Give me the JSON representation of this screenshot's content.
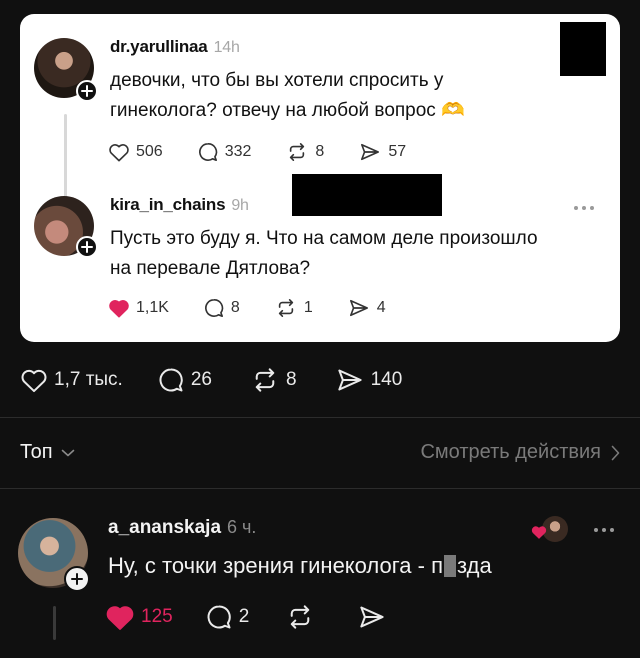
{
  "quoted_card": {
    "post": {
      "username": "dr.yarullinaa",
      "time": "14h",
      "text_line1": "девочки, что бы вы хотели спросить у",
      "text_line2": "гинеколога? отвечу на любой вопрос 🫶",
      "likes": "506",
      "replies": "332",
      "reposts": "8",
      "shares": "57"
    },
    "reply": {
      "username": "kira_in_chains",
      "time": "9h",
      "text_line1": "Пусть это буду я. Что на самом деле произошло",
      "text_line2": "на перевале Дятлова?",
      "likes": "1,1K",
      "replies": "8",
      "reposts": "1",
      "shares": "4"
    }
  },
  "post_stats": {
    "likes": "1,7 тыс.",
    "replies": "26",
    "reposts": "8",
    "shares": "140"
  },
  "sort_bar": {
    "sort_label": "Топ",
    "view_activity": "Смотреть действия"
  },
  "comment": {
    "username": "a_ananskaja",
    "time": "6 ч.",
    "text_before": "Ну, с точки зрения гинеколога - п",
    "text_after": "зда",
    "likes": "125",
    "replies": "2"
  },
  "colors": {
    "background": "#101010",
    "card": "#ffffff",
    "like_red": "#e0245e",
    "muted": "#7a7a7a"
  }
}
